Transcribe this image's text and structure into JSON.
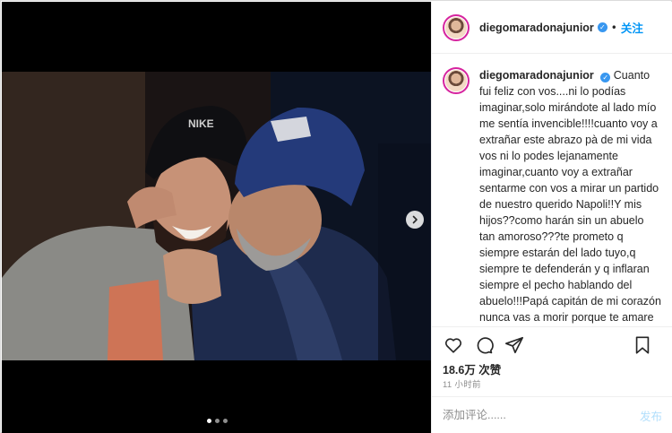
{
  "post": {
    "username": "diegomaradonajunior",
    "separator": "•",
    "follow_label": "关注",
    "caption": "Cuanto fui feliz con vos....ni lo podías imaginar,solo mirándote al lado mío me sentía invencible!!!!cuanto voy a extrañar este abrazo pà de mi vida vos ni lo podes lejanamente imaginar,cuanto voy a extrañar sentarme con vos a mirar un partido de nuestro querido Napoli!!Y mis hijos??como harán sin un abuelo tan amoroso???te prometo q siempre estarán del lado tuyo,q siempre te defenderán y q inflaran siempre el pecho hablando del abuelo!!!Papá capitán de mi corazón nunca vas a morir porque te amare hasta el último respiro q voy a tener!!Esperame y venime a buscar vos cuando llegara mi hora porque siempre te quise al lado mío porque un hijo al lado de un",
    "likes": "18.6万 次赞",
    "time_ago": "11 小时前",
    "comment_placeholder": "添加评论......",
    "post_label": "发布",
    "carousel": {
      "total": 3,
      "current": 1
    }
  },
  "colors": {
    "accent": "#0095f6",
    "verified": "#3897f0",
    "post_disabled": "#b2dffc",
    "text": "#262626",
    "muted": "#8e8e8e"
  },
  "icons": [
    "heart-icon",
    "comment-icon",
    "share-icon",
    "bookmark-icon",
    "chevron-right-icon",
    "verified-icon"
  ]
}
